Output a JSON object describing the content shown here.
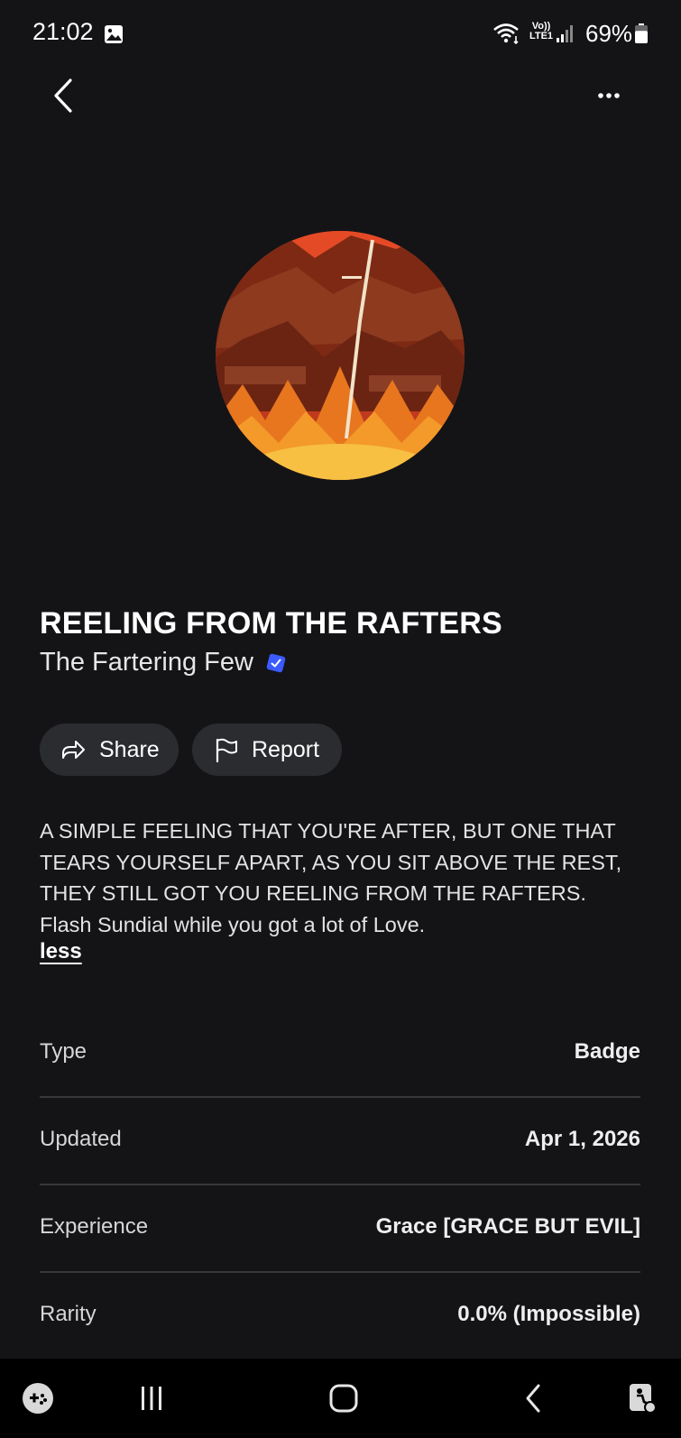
{
  "status_bar": {
    "time": "21:02",
    "network_label": "Vo)) LTE1",
    "battery_percent": "69%",
    "battery_level": 0.69,
    "icons": [
      "gallery-icon",
      "wifi-icon",
      "signal-icon",
      "battery-icon"
    ]
  },
  "header": {
    "back_icon": "chevron-left-icon",
    "more_icon": "more-horizontal-icon"
  },
  "item": {
    "title": "REELING FROM THE RAFTERS",
    "creator": "The Fartering Few",
    "verified_icon": "verified-badge-icon",
    "verified_color": "#3b5bff"
  },
  "actions": {
    "share_label": "Share",
    "report_label": "Report"
  },
  "description": {
    "lines": [
      "A SIMPLE FEELING THAT YOU'RE AFTER, BUT ONE THAT",
      "TEARS YOURSELF APART, AS YOU SIT ABOVE THE REST,",
      "THEY STILL GOT YOU REELING FROM THE RAFTERS.",
      "Flash Sundial while you got a lot of Love."
    ],
    "toggle_label": "less"
  },
  "details": [
    {
      "label": "Type",
      "value": "Badge"
    },
    {
      "label": "Updated",
      "value": "Apr 1, 2026"
    },
    {
      "label": "Experience",
      "value": "Grace [GRACE BUT EVIL]"
    },
    {
      "label": "Rarity",
      "value": "0.0% (Impossible)"
    }
  ],
  "nav_bar": {
    "icons": [
      "game-launcher-icon",
      "recent-apps-icon",
      "home-icon",
      "back-icon",
      "accessibility-icon"
    ]
  },
  "colors": {
    "background": "#141417",
    "pill_background": "#2b2c30",
    "divider": "#37383c"
  }
}
